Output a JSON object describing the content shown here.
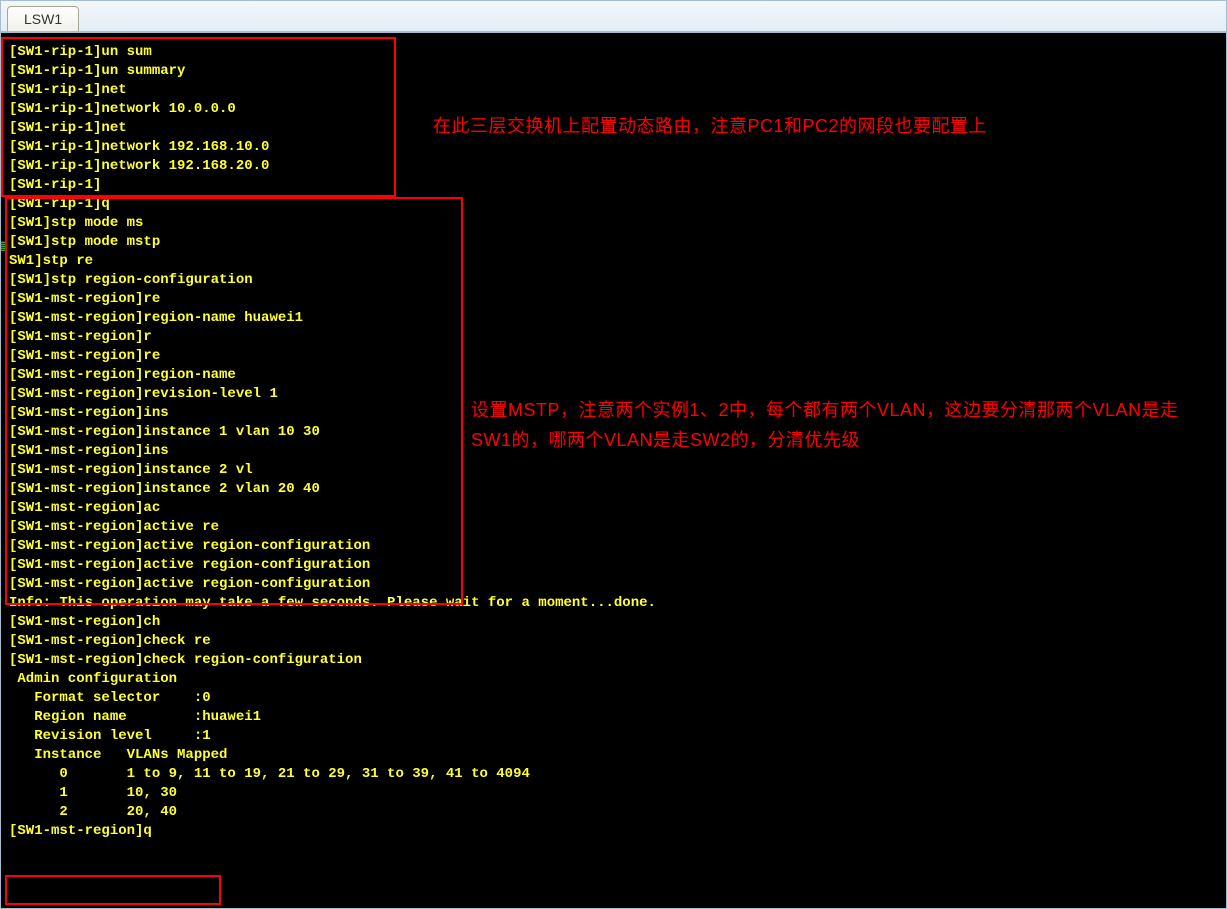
{
  "tab": {
    "label": "LSW1"
  },
  "annotations": {
    "a1": "在此三层交换机上配置动态路由，注意PC1和PC2的网段也要配置上",
    "a2": "设置MSTP，注意两个实例1、2中，每个都有两个VLAN，这边要分清那两个VLAN是走SW1的，哪两个VLAN是走SW2的，分清优先级"
  },
  "lines": [
    "[SW1-rip-1]un sum",
    "[SW1-rip-1]un summary",
    "[SW1-rip-1]net",
    "[SW1-rip-1]network 10.0.0.0",
    "[SW1-rip-1]net",
    "[SW1-rip-1]network 192.168.10.0",
    "[SW1-rip-1]network 192.168.20.0",
    "[SW1-rip-1]",
    "[SW1-rip-1]q",
    "[SW1]stp mode ms",
    "[SW1]stp mode mstp",
    "SW1]stp re",
    "[SW1]stp region-configuration",
    "[SW1-mst-region]re",
    "[SW1-mst-region]region-name huawei1",
    "[SW1-mst-region]r",
    "[SW1-mst-region]re",
    "[SW1-mst-region]region-name",
    "[SW1-mst-region]revision-level 1",
    "[SW1-mst-region]ins",
    "[SW1-mst-region]instance 1 vlan 10 30",
    "[SW1-mst-region]ins",
    "[SW1-mst-region]instance 2 vl",
    "[SW1-mst-region]instance 2 vlan 20 40",
    "[SW1-mst-region]ac",
    "[SW1-mst-region]active re",
    "[SW1-mst-region]active region-configuration",
    "[SW1-mst-region]active region-configuration",
    "[SW1-mst-region]active region-configuration",
    "Info: This operation may take a few seconds. Please wait for a moment...done.",
    "[SW1-mst-region]ch",
    "[SW1-mst-region]check re",
    "[SW1-mst-region]check region-configuration",
    " Admin configuration",
    "   Format selector    :0             ",
    "   Region name        :huawei1             ",
    "   Revision level     :1",
    "",
    "   Instance   VLANs Mapped",
    "      0       1 to 9, 11 to 19, 21 to 29, 31 to 39, 41 to 4094",
    "      1       10, 30",
    "      2       20, 40",
    "[SW1-mst-region]q"
  ],
  "mstp_table": {
    "admin_label": "Admin configuration",
    "format_selector": 0,
    "region_name": "huawei1",
    "revision_level": 1,
    "instances": [
      {
        "instance": 0,
        "vlans": "1 to 9, 11 to 19, 21 to 29, 31 to 39, 41 to 4094"
      },
      {
        "instance": 1,
        "vlans": "10, 30"
      },
      {
        "instance": 2,
        "vlans": "20, 40"
      }
    ]
  }
}
